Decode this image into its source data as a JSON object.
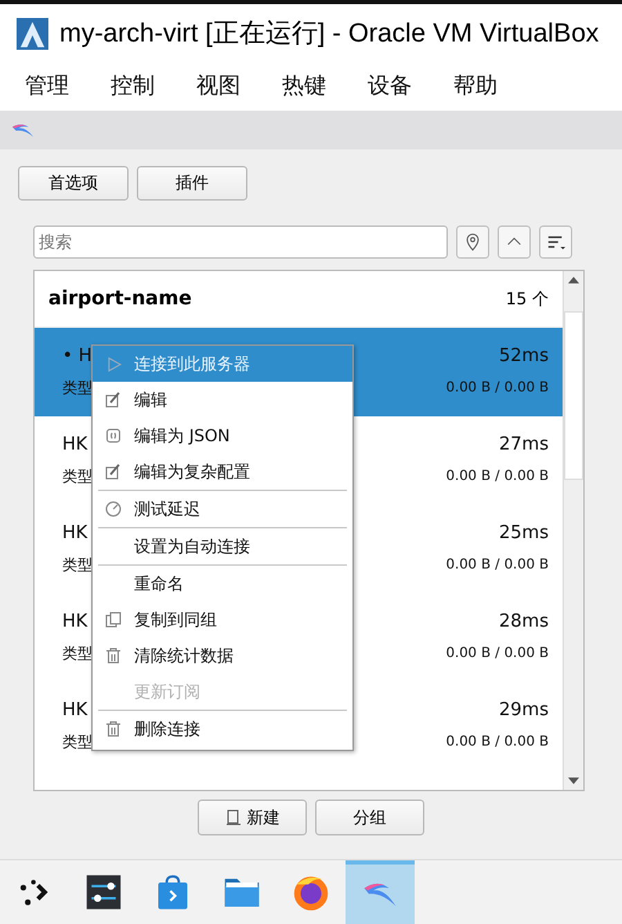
{
  "window": {
    "title": "my-arch-virt [正在运行] - Oracle VM VirtualBox"
  },
  "menu_bar": [
    "管理",
    "控制",
    "视图",
    "热键",
    "设备",
    "帮助"
  ],
  "buttons": [
    "首选项",
    "插件"
  ],
  "search": {
    "placeholder": "搜索"
  },
  "group": {
    "name": "airport-name",
    "count": "15 个"
  },
  "rows": [
    {
      "name": "• H",
      "type": "类型",
      "latency": "52ms",
      "traffic": "0.00 B / 0.00 B",
      "selected": true
    },
    {
      "name": "HK",
      "type": "类型",
      "latency": "27ms",
      "traffic": "0.00 B / 0.00 B",
      "selected": false
    },
    {
      "name": "HK",
      "type": "类型",
      "latency": "25ms",
      "traffic": "0.00 B / 0.00 B",
      "selected": false
    },
    {
      "name": "HK",
      "type": "类型",
      "latency": "28ms",
      "traffic": "0.00 B / 0.00 B",
      "selected": false
    },
    {
      "name": "HK",
      "type": "类型",
      "latency": "29ms",
      "traffic": "0.00 B / 0.00 B",
      "selected": false
    }
  ],
  "context_menu": [
    {
      "kind": "item",
      "label": "连接到此服务器",
      "selected": true,
      "disabled": false
    },
    {
      "kind": "item",
      "label": "编辑",
      "selected": false,
      "disabled": false
    },
    {
      "kind": "item",
      "label": "编辑为 JSON",
      "selected": false,
      "disabled": false
    },
    {
      "kind": "item",
      "label": "编辑为复杂配置",
      "selected": false,
      "disabled": false
    },
    {
      "kind": "separator"
    },
    {
      "kind": "item",
      "label": "测试延迟",
      "selected": false,
      "disabled": false
    },
    {
      "kind": "separator"
    },
    {
      "kind": "item",
      "label": "设置为自动连接",
      "selected": false,
      "disabled": false
    },
    {
      "kind": "separator"
    },
    {
      "kind": "item",
      "label": "重命名",
      "selected": false,
      "disabled": false
    },
    {
      "kind": "item",
      "label": "复制到同组",
      "selected": false,
      "disabled": false
    },
    {
      "kind": "item",
      "label": "清除统计数据",
      "selected": false,
      "disabled": false
    },
    {
      "kind": "item",
      "label": "更新订阅",
      "selected": false,
      "disabled": true
    },
    {
      "kind": "separator"
    },
    {
      "kind": "item",
      "label": "删除连接",
      "selected": false,
      "disabled": false
    }
  ],
  "bottom_buttons": [
    "新建",
    "分组"
  ],
  "taskbar": [
    {
      "selected": false
    },
    {
      "selected": false
    },
    {
      "selected": false
    },
    {
      "selected": false
    },
    {
      "selected": false
    },
    {
      "selected": true
    }
  ]
}
